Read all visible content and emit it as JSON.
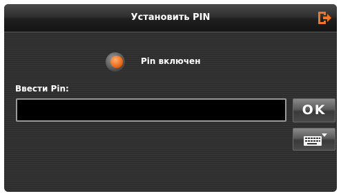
{
  "header": {
    "title": "Установить PIN",
    "exit_icon": "exit-icon",
    "accent_color": "#f47420"
  },
  "pin_toggle": {
    "label": "Pin включен",
    "state": "on",
    "icon": "radio-toggle-icon"
  },
  "pin_entry": {
    "label": "Ввести Pin:",
    "value": ""
  },
  "buttons": {
    "ok_label": "OK",
    "keyboard_icon": "keyboard-icon"
  }
}
